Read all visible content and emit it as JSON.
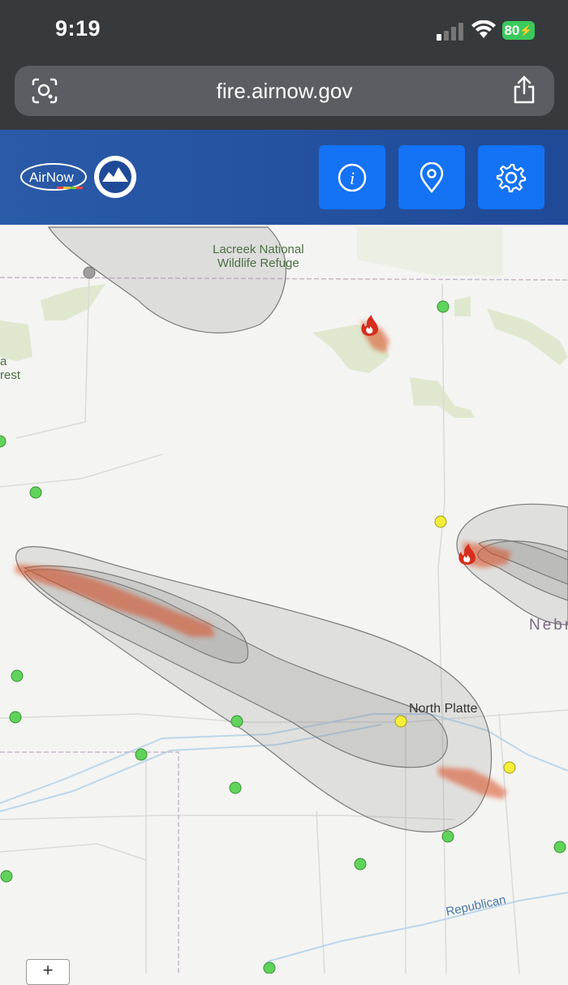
{
  "status_bar": {
    "time": "9:19",
    "battery": "80"
  },
  "browser": {
    "url": "fire.airnow.gov"
  },
  "header": {
    "logo_text": "AirNow"
  },
  "map": {
    "labels": {
      "lacreek_line1": "Lacreek National",
      "lacreek_line2": "Wildlife Refuge",
      "forest_a": "a",
      "forest_rest": "rest",
      "north_platte": "North Platte",
      "nebraska": "Nebr",
      "republican": "Republican"
    },
    "colors": {
      "monitor_good": "#5fd35a",
      "monitor_moderate": "#f5ef3a",
      "smoke": "#8c8c8c",
      "fire": "#d94a1c"
    }
  },
  "controls": {
    "zoom_in": "+"
  }
}
